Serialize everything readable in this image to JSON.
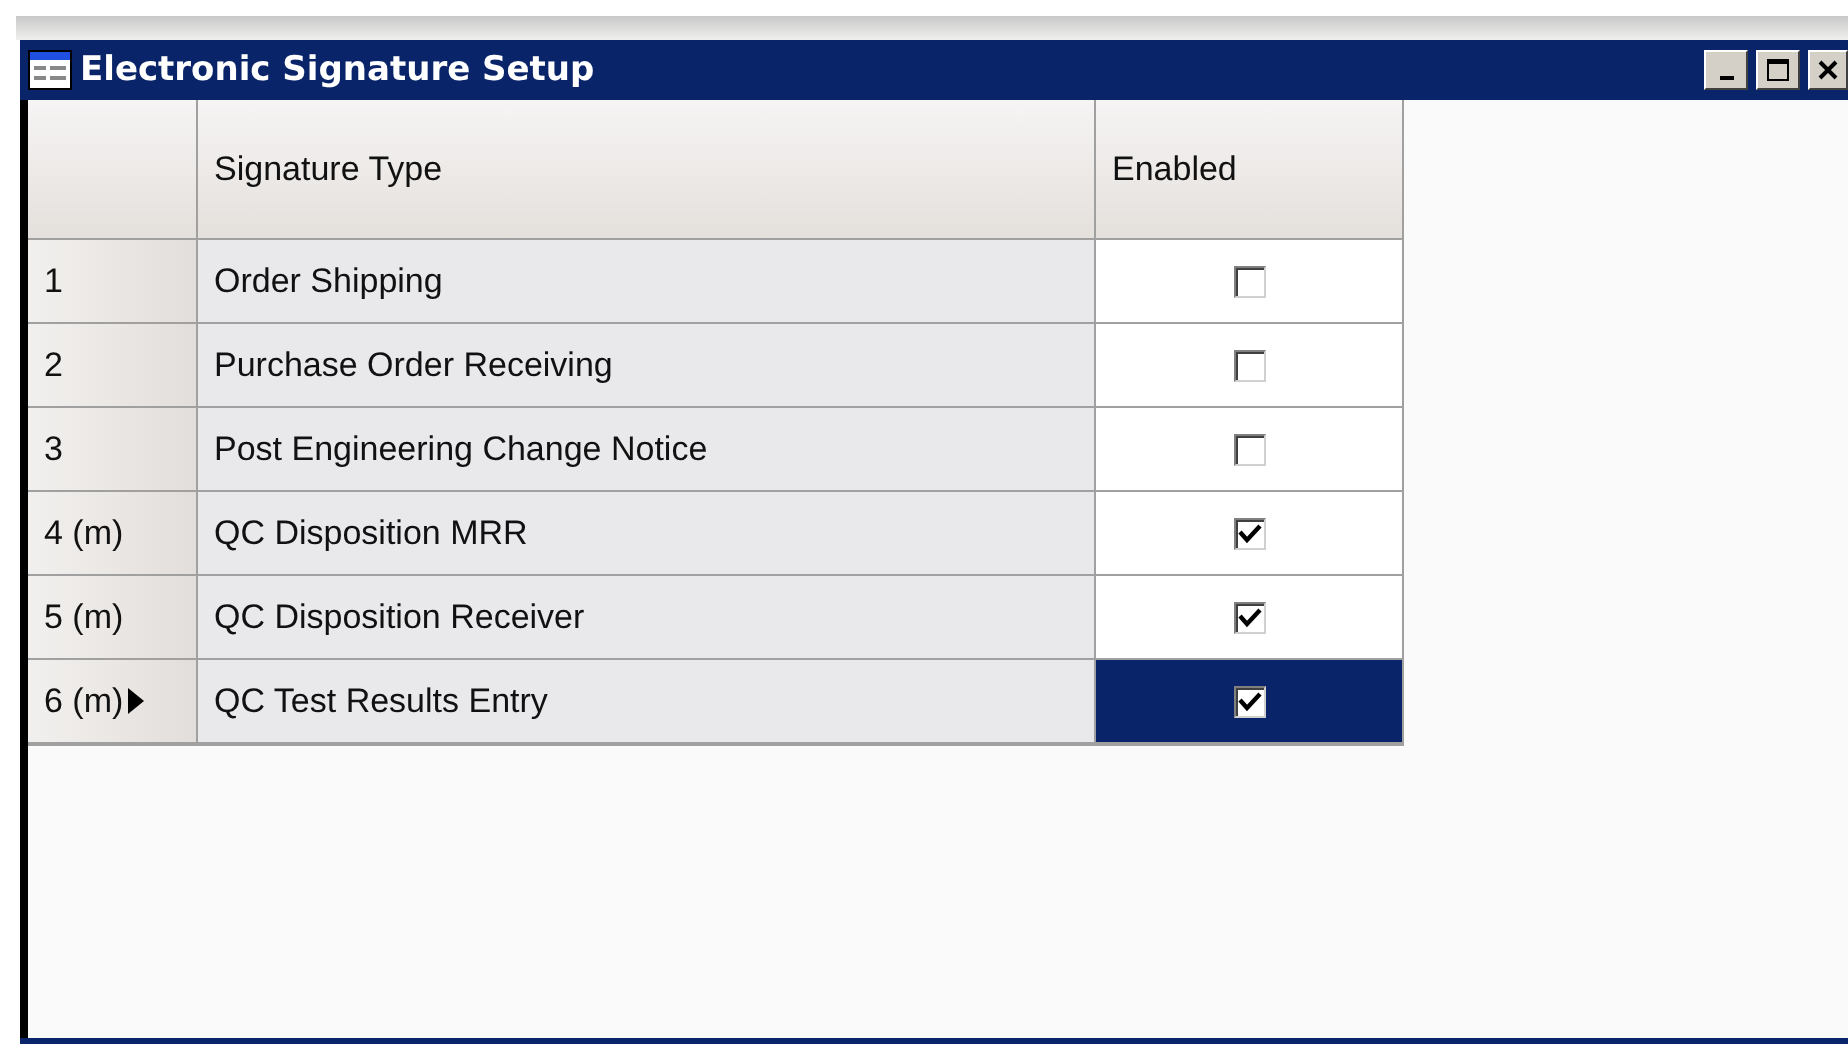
{
  "window": {
    "title": "Electronic Signature Setup"
  },
  "table": {
    "columns": [
      "Signature Type",
      "Enabled"
    ],
    "rows": [
      {
        "header": "1",
        "type": "Order Shipping",
        "enabled": false,
        "selected": false
      },
      {
        "header": "2",
        "type": "Purchase Order Receiving",
        "enabled": false,
        "selected": false
      },
      {
        "header": "3",
        "type": "Post Engineering Change Notice",
        "enabled": false,
        "selected": false
      },
      {
        "header": "4 (m)",
        "type": "QC Disposition MRR",
        "enabled": true,
        "selected": false
      },
      {
        "header": "5 (m)",
        "type": "QC Disposition Receiver",
        "enabled": true,
        "selected": false
      },
      {
        "header": "6 (m)",
        "type": "QC Test Results Entry",
        "enabled": true,
        "selected": true
      }
    ]
  }
}
